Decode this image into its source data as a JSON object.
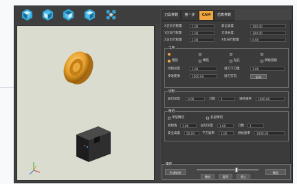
{
  "toolbar": {
    "buttons": [
      {
        "name": "view-iso-1",
        "icon": "cube-icon"
      },
      {
        "name": "view-iso-2",
        "icon": "cube-icon"
      },
      {
        "name": "view-iso-3",
        "icon": "cube-icon"
      },
      {
        "name": "view-iso-4",
        "icon": "cube-icon"
      },
      {
        "name": "view-fit",
        "icon": "expand-icon"
      }
    ]
  },
  "tabs": [
    {
      "label": "刀具参数"
    },
    {
      "label": "第一步"
    },
    {
      "label": "CAM",
      "active": true
    },
    {
      "label": "仿真参数"
    }
  ],
  "params": {
    "row1": {
      "l1": "X正负行程量",
      "v1": "1.00",
      "l2": "安全高度",
      "v2": "100.00"
    },
    "row2": {
      "l1": "Y正负行程量",
      "v1": "1.00",
      "l2": "刀具长度",
      "v2": "100.00"
    },
    "row3": {
      "l1": "Z正负行程量",
      "v1": "1.00",
      "l2": "X负向行程量",
      "v2": "0.00"
    }
  },
  "group_process": {
    "title": "工序",
    "radios": [
      "粗加工",
      "半精加工",
      "精加工",
      "清角加工"
    ],
    "checks": [
      "粗铣",
      "精铣",
      "钻孔",
      "倒角铣削"
    ],
    "row_a": {
      "l1": "切削深度",
      "v1": "1.00",
      "l2": "进刀下刀量",
      "v2": "1.00"
    },
    "row_b": {
      "l1": "步进距离",
      "v1": "1000.00",
      "l2": "进刀方向",
      "btn": "反向"
    }
  },
  "group_cut": {
    "title": "切削",
    "row": {
      "l1": "层切深度",
      "v1": "0.00",
      "l2": "刀数",
      "v2": "1",
      "l3": "进给速率",
      "v3": "1000.00"
    }
  },
  "group_finish": {
    "title": "精切",
    "checks": [
      "单层精切",
      "多层精切"
    ],
    "row_a": {
      "l1": "初始角",
      "v1": "1.00",
      "l2": "层切深度",
      "v2": "1.00",
      "l3": "刀数",
      "v3": "1"
    },
    "row_b": {
      "l1": "安全高度",
      "v1": "50.00",
      "l2": "下刀速率",
      "v2": "1.00",
      "l3": "进给速率",
      "v3": "1000.00"
    }
  },
  "bottom": {
    "title": "操作",
    "left_button": "生成轨迹",
    "buttons": [
      "播放",
      "暂停",
      "停止"
    ],
    "right_button": "确定"
  },
  "slider": {
    "value_fraction": 0.65
  },
  "colors": {
    "accent": "#f0a640",
    "cube_icon": "#33a6d6"
  }
}
